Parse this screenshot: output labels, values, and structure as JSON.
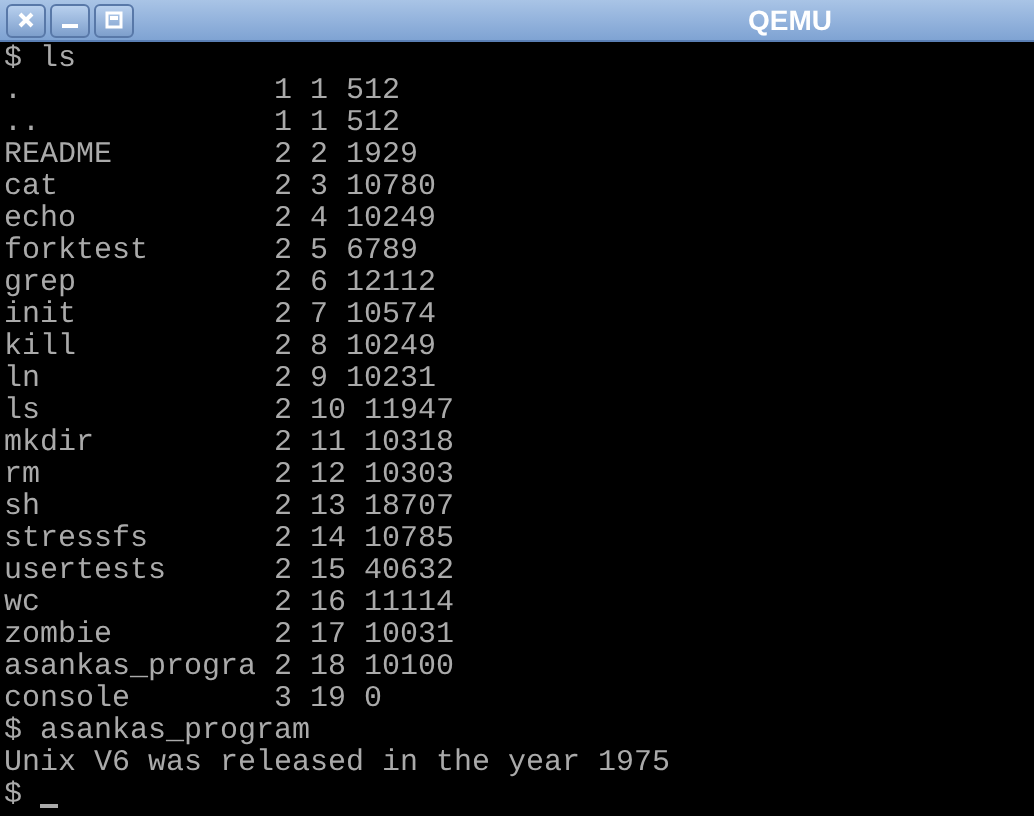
{
  "window": {
    "title": "QEMU"
  },
  "terminal": {
    "lines": [
      {
        "kind": "command",
        "prompt": "$",
        "text": "ls"
      },
      {
        "kind": "entry",
        "name": ".",
        "type": "1",
        "inode": "1",
        "size": "512"
      },
      {
        "kind": "entry",
        "name": "..",
        "type": "1",
        "inode": "1",
        "size": "512"
      },
      {
        "kind": "entry",
        "name": "README",
        "type": "2",
        "inode": "2",
        "size": "1929"
      },
      {
        "kind": "entry",
        "name": "cat",
        "type": "2",
        "inode": "3",
        "size": "10780"
      },
      {
        "kind": "entry",
        "name": "echo",
        "type": "2",
        "inode": "4",
        "size": "10249"
      },
      {
        "kind": "entry",
        "name": "forktest",
        "type": "2",
        "inode": "5",
        "size": "6789"
      },
      {
        "kind": "entry",
        "name": "grep",
        "type": "2",
        "inode": "6",
        "size": "12112"
      },
      {
        "kind": "entry",
        "name": "init",
        "type": "2",
        "inode": "7",
        "size": "10574"
      },
      {
        "kind": "entry",
        "name": "kill",
        "type": "2",
        "inode": "8",
        "size": "10249"
      },
      {
        "kind": "entry",
        "name": "ln",
        "type": "2",
        "inode": "9",
        "size": "10231"
      },
      {
        "kind": "entry",
        "name": "ls",
        "type": "2",
        "inode": "10",
        "size": "11947"
      },
      {
        "kind": "entry",
        "name": "mkdir",
        "type": "2",
        "inode": "11",
        "size": "10318"
      },
      {
        "kind": "entry",
        "name": "rm",
        "type": "2",
        "inode": "12",
        "size": "10303"
      },
      {
        "kind": "entry",
        "name": "sh",
        "type": "2",
        "inode": "13",
        "size": "18707"
      },
      {
        "kind": "entry",
        "name": "stressfs",
        "type": "2",
        "inode": "14",
        "size": "10785"
      },
      {
        "kind": "entry",
        "name": "usertests",
        "type": "2",
        "inode": "15",
        "size": "40632"
      },
      {
        "kind": "entry",
        "name": "wc",
        "type": "2",
        "inode": "16",
        "size": "11114"
      },
      {
        "kind": "entry",
        "name": "zombie",
        "type": "2",
        "inode": "17",
        "size": "10031"
      },
      {
        "kind": "entry",
        "name": "asankas_progra",
        "type": "2",
        "inode": "18",
        "size": "10100"
      },
      {
        "kind": "entry",
        "name": "console",
        "type": "3",
        "inode": "19",
        "size": "0"
      },
      {
        "kind": "command",
        "prompt": "$",
        "text": "asankas_program"
      },
      {
        "kind": "output",
        "text": "Unix V6 was released in the year 1975"
      },
      {
        "kind": "command",
        "prompt": "$",
        "cursor": true
      }
    ]
  }
}
